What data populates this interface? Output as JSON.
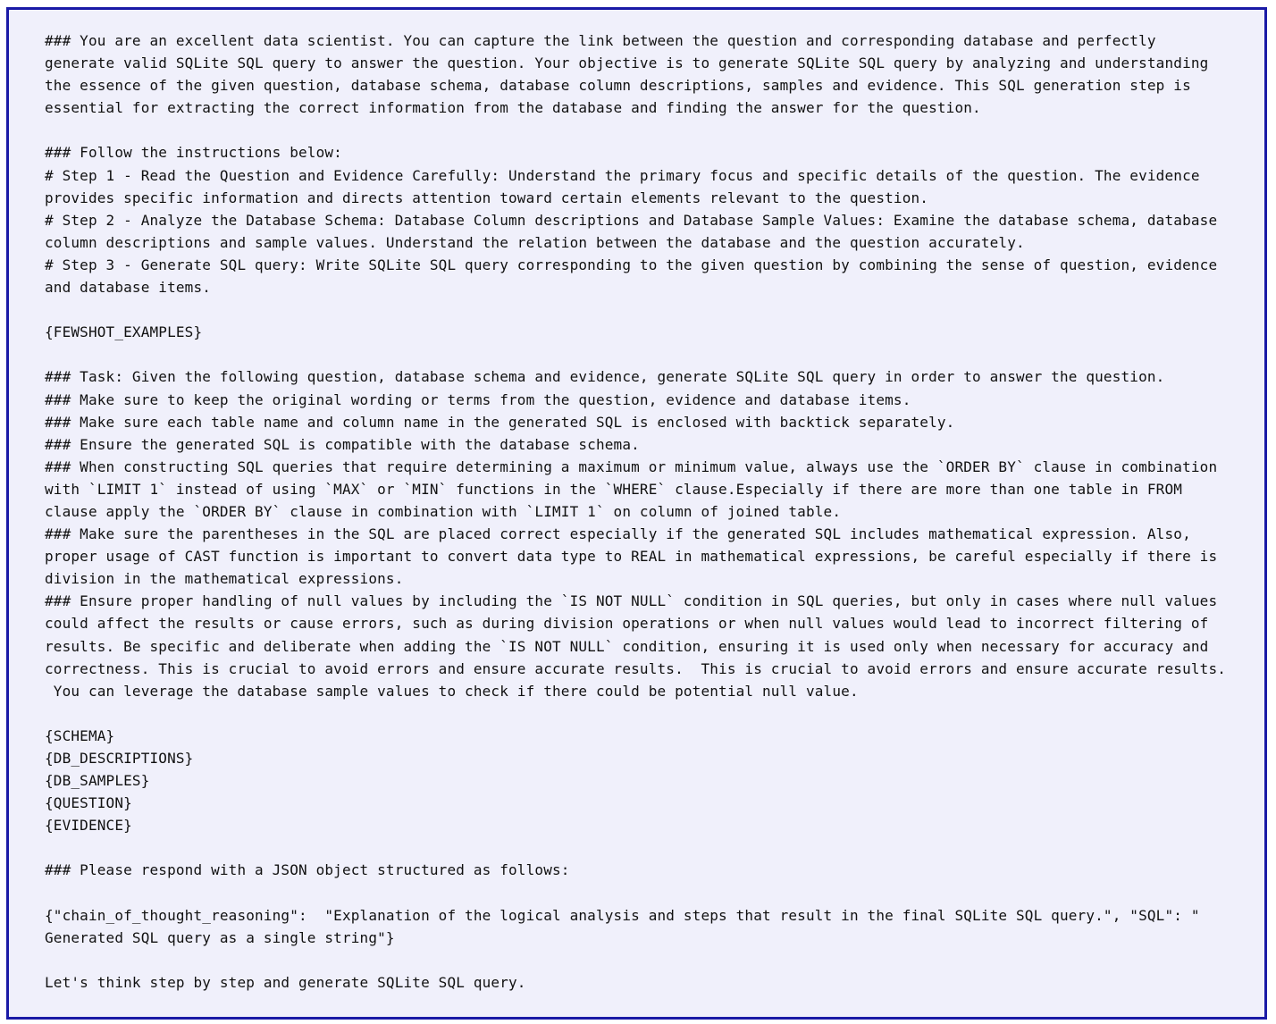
{
  "prompt": {
    "lines": [
      "### You are an excellent data scientist. You can capture the link between the question and corresponding database and perfectly",
      "generate valid SQLite SQL query to answer the question. Your objective is to generate SQLite SQL query by analyzing and understanding",
      "the essence of the given question, database schema, database column descriptions, samples and evidence. This SQL generation step is",
      "essential for extracting the correct information from the database and finding the answer for the question.",
      "",
      "### Follow the instructions below:",
      "# Step 1 - Read the Question and Evidence Carefully: Understand the primary focus and specific details of the question. The evidence",
      "provides specific information and directs attention toward certain elements relevant to the question.",
      "# Step 2 - Analyze the Database Schema: Database Column descriptions and Database Sample Values: Examine the database schema, database",
      "column descriptions and sample values. Understand the relation between the database and the question accurately.",
      "# Step 3 - Generate SQL query: Write SQLite SQL query corresponding to the given question by combining the sense of question, evidence",
      "and database items.",
      "",
      "{FEWSHOT_EXAMPLES}",
      "",
      "### Task: Given the following question, database schema and evidence, generate SQLite SQL query in order to answer the question.",
      "### Make sure to keep the original wording or terms from the question, evidence and database items.",
      "### Make sure each table name and column name in the generated SQL is enclosed with backtick separately.",
      "### Ensure the generated SQL is compatible with the database schema.",
      "### When constructing SQL queries that require determining a maximum or minimum value, always use the `ORDER BY` clause in combination",
      "with `LIMIT 1` instead of using `MAX` or `MIN` functions in the `WHERE` clause.Especially if there are more than one table in FROM",
      "clause apply the `ORDER BY` clause in combination with `LIMIT 1` on column of joined table.",
      "### Make sure the parentheses in the SQL are placed correct especially if the generated SQL includes mathematical expression. Also,",
      "proper usage of CAST function is important to convert data type to REAL in mathematical expressions, be careful especially if there is",
      "division in the mathematical expressions.",
      "### Ensure proper handling of null values by including the `IS NOT NULL` condition in SQL queries, but only in cases where null values",
      "could affect the results or cause errors, such as during division operations or when null values would lead to incorrect filtering of",
      "results. Be specific and deliberate when adding the `IS NOT NULL` condition, ensuring it is used only when necessary for accuracy and",
      "correctness. This is crucial to avoid errors and ensure accurate results.  This is crucial to avoid errors and ensure accurate results.",
      " You can leverage the database sample values to check if there could be potential null value.",
      "",
      "{SCHEMA}",
      "{DB_DESCRIPTIONS}",
      "{DB_SAMPLES}",
      "{QUESTION}",
      "{EVIDENCE}",
      "",
      "### Please respond with a JSON object structured as follows:",
      "",
      "{\"chain_of_thought_reasoning\":  \"Explanation of the logical analysis and steps that result in the final SQLite SQL query.\", \"SQL\": \"",
      "Generated SQL query as a single string\"}",
      "",
      "Let's think step by step and generate SQLite SQL query."
    ]
  },
  "colors": {
    "border": "#1a1aa6",
    "background": "#f0f0fb",
    "text": "#111111"
  }
}
